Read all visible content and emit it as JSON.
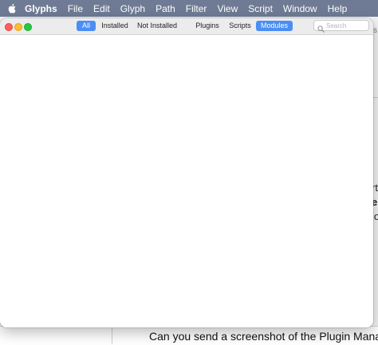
{
  "menubar": {
    "items": [
      "Glyphs",
      "File",
      "Edit",
      "Glyph",
      "Path",
      "Filter",
      "View",
      "Script",
      "Window",
      "Help"
    ]
  },
  "window": {
    "tabs": [
      "All",
      "Installed",
      "Not Installed",
      "Plugins",
      "Scripts",
      "Modules"
    ],
    "selected_tabs": [
      "All",
      "Modules"
    ],
    "search_placeholder": "Search"
  },
  "background": {
    "caption": "Can you send a screenshot of the Plugin Manager > Mo",
    "peek_fragments": [
      "rt",
      "el",
      "io",
      "s"
    ]
  },
  "colors": {
    "menubar": "#6f7b95",
    "selected_tab": "#4b8ef3",
    "close": "#ff5f57",
    "minimize": "#febc2e",
    "zoom": "#28c840"
  }
}
